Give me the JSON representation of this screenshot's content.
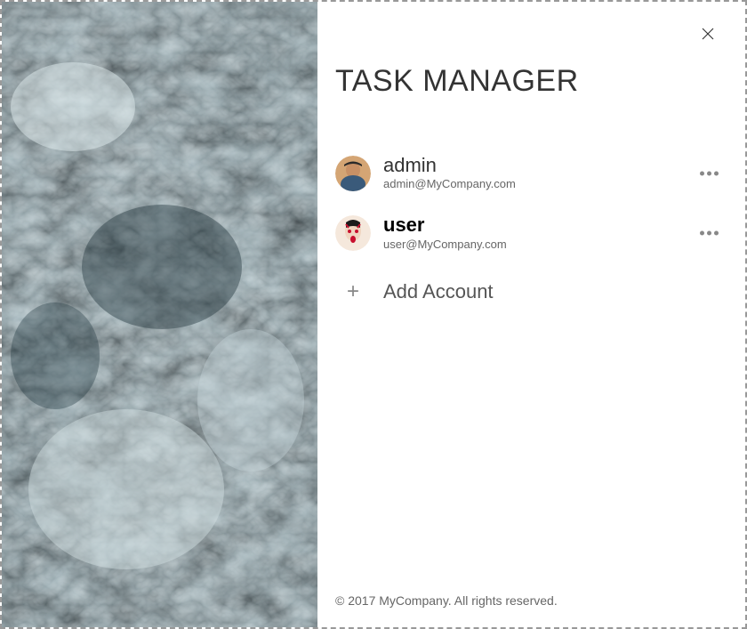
{
  "app_title": "TASK MANAGER",
  "accounts": [
    {
      "name": "admin",
      "email": "admin@MyCompany.com",
      "bold": false
    },
    {
      "name": "user",
      "email": "user@MyCompany.com",
      "bold": true
    }
  ],
  "add_account_label": "Add Account",
  "footer_text": "© 2017 MyCompany. All rights reserved."
}
